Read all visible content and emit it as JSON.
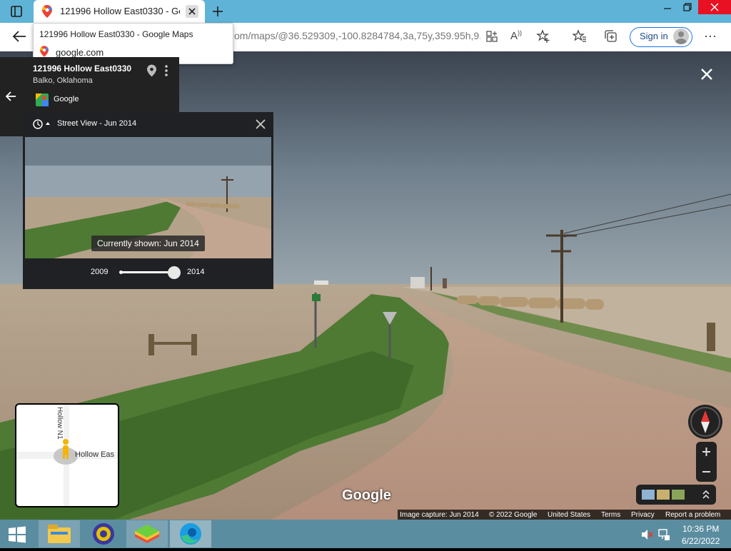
{
  "browser": {
    "tab_title": "121996 Hollow East0330 - Google Maps",
    "tooltip_title": "121996 Hollow East0330 - Google Maps",
    "tooltip_domain": "google.com",
    "url": "om/maps/@36.529309,-100.8284784,3a,75y,359.95h,9...",
    "signin_label": "Sign in"
  },
  "place": {
    "title": "121996 Hollow East0330",
    "location": "Balko, Oklahoma",
    "provider": "Google"
  },
  "history": {
    "header": "Street View - Jun 2014",
    "currently_shown": "Currently shown: Jun 2014",
    "year_start": "2009",
    "year_end": "2014",
    "slider_value": 1.0
  },
  "minimap": {
    "road_v": "Hollow N1",
    "road_h": "Hollow Eas"
  },
  "watermark": "Google",
  "attribution": {
    "capture": "Image capture: Jun 2014",
    "copyright": "© 2022 Google",
    "country": "United States",
    "terms": "Terms",
    "privacy": "Privacy",
    "report": "Report a problem"
  },
  "taskbar": {
    "time": "10:36 PM",
    "date": "6/22/2022"
  },
  "icons": {
    "maps": "map-pin-icon",
    "close": "close-icon",
    "back": "back-arrow-icon"
  }
}
